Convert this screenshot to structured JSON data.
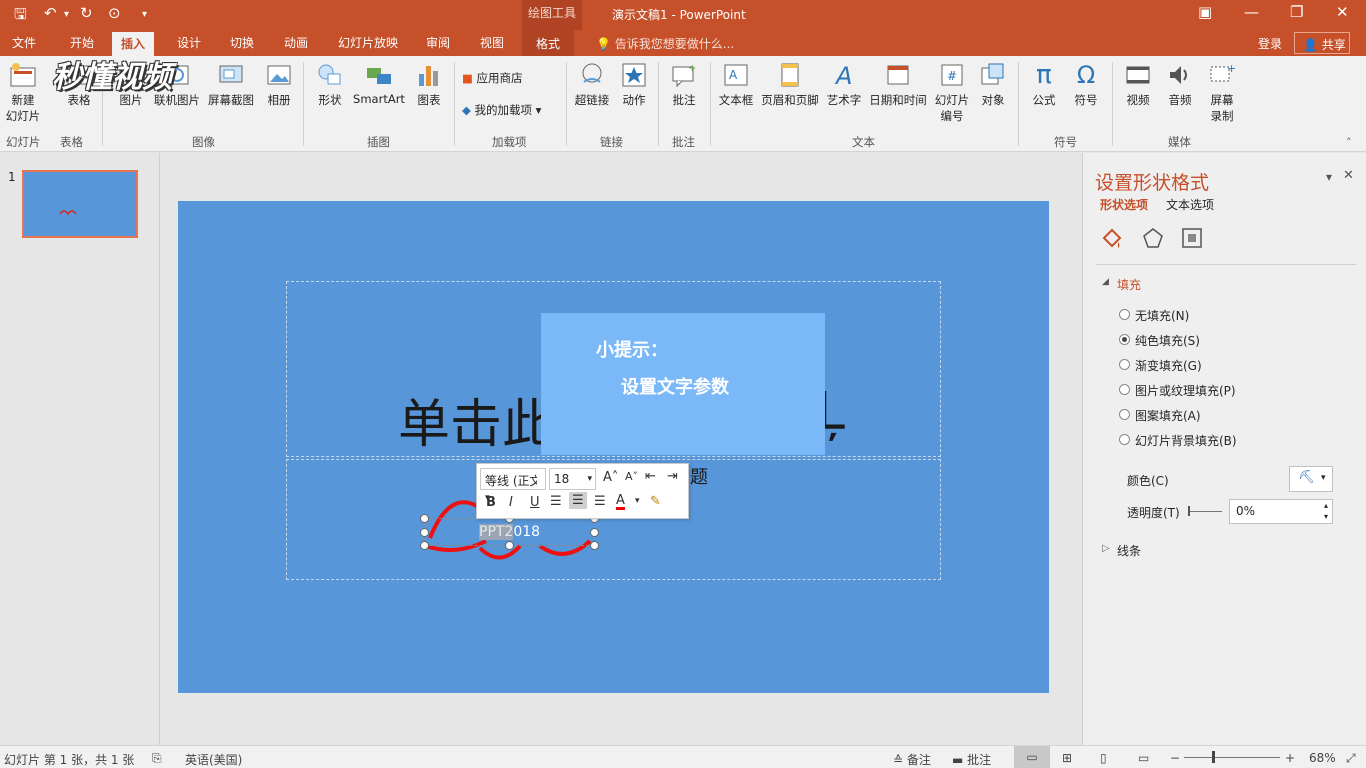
{
  "titlebar": {
    "quick_access": {
      "save": "🖫",
      "undo": "↶",
      "undo_arrow": "▾",
      "redo": "↻",
      "present": "⊙",
      "customize": "▾"
    },
    "context_group": "绘图工具",
    "title": "演示文稿1 - PowerPoint",
    "win": {
      "ribbon_opts": "▣",
      "min": "—",
      "restore": "❐",
      "close": "✕"
    }
  },
  "tabs": [
    "文件",
    "开始",
    "插入",
    "设计",
    "切换",
    "动画",
    "幻灯片放映",
    "审阅",
    "视图"
  ],
  "context_tab": "格式",
  "tell_me": "告诉我您想要做什么...",
  "login": "登录",
  "share": "共享",
  "watermark": "秒懂视频",
  "ribbon": {
    "buttons": {
      "new_slide": "新建\n幻灯片",
      "table": "表格",
      "picture": "图片",
      "online_picture": "联机图片",
      "screenshot": "屏幕截图",
      "album": "相册",
      "shapes": "形状",
      "smartart": "SmartArt",
      "chart": "图表",
      "store": "应用商店",
      "my_addins": "我的加载项",
      "hyperlink": "超链接",
      "action": "动作",
      "comment": "批注",
      "textbox": "文本框",
      "header_footer": "页眉和页脚",
      "wordart": "艺术字",
      "datetime": "日期和时间",
      "slide_number": "幻灯片\n编号",
      "object": "对象",
      "equation": "公式",
      "symbol": "符号",
      "video": "视频",
      "audio": "音频",
      "screen_record": "屏幕\n录制"
    },
    "groups": {
      "slides": "幻灯片",
      "tables": "表格",
      "images": "图像",
      "illustrations": "插图",
      "addins": "加载项",
      "links": "链接",
      "comments": "批注",
      "text": "文本",
      "symbols": "符号",
      "media": "媒体"
    }
  },
  "thumbnail": {
    "number": "1"
  },
  "slide": {
    "title_visible": "单击此",
    "title_tail": "Ļ",
    "subtitle_tail": "题",
    "tip_heading": "小提示：",
    "tip_body": "设置文字参数",
    "selected_text_highlight": "PPT2",
    "selected_text_rest": "018"
  },
  "mini_toolbar": {
    "font": "等线 (正文",
    "size": "18",
    "grow": "A˄",
    "shrink": "A˅",
    "bold": "B",
    "italic": "I",
    "underline": "U",
    "font_color": "A"
  },
  "format_pane": {
    "title": "设置形状格式",
    "tab_shape": "形状选项",
    "tab_text": "文本选项",
    "fill_section": "填充",
    "fill_options": [
      "无填充(N)",
      "纯色填充(S)",
      "渐变填充(G)",
      "图片或纹理填充(P)",
      "图案填充(A)",
      "幻灯片背景填充(B)"
    ],
    "fill_selected_index": 1,
    "color_label": "颜色(C)",
    "transparency_label": "透明度(T)",
    "transparency_value": "0%",
    "line_section": "线条",
    "collapse": "▾",
    "close": "✕"
  },
  "statusbar": {
    "slide_info": "幻灯片 第 1 张，共 1 张",
    "language": "英语(美国)",
    "notes": "备注",
    "comments": "批注",
    "zoom": "68%"
  },
  "colors": {
    "accent": "#c6502a",
    "slide_bg": "#5796d8",
    "tip_bg": "#7ab8f8"
  }
}
